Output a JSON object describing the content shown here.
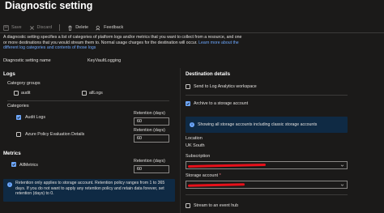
{
  "title": "Diagnostic setting",
  "toolbar": {
    "save": "Save",
    "discard": "Discard",
    "delete": "Delete",
    "feedback": "Feedback"
  },
  "description": {
    "text": "A diagnostic setting specifies a list of categories of platform logs and/or metrics that you want to collect from a resource, and one or more destinations that you would stream them to. Normal usage charges for the destination will occur.",
    "link1": "Learn",
    "link2": "more about the different log categories and contents of those logs"
  },
  "setting_name": {
    "label": "Diagnostic setting name",
    "value": "KeyVaultLogging"
  },
  "logs": {
    "heading": "Logs",
    "category_groups": {
      "label": "Category groups",
      "items": [
        {
          "label": "audit",
          "checked": false
        },
        {
          "label": "allLogs",
          "checked": false
        }
      ]
    },
    "categories": {
      "label": "Categories",
      "items": [
        {
          "label": "Audit Logs",
          "checked": true,
          "retention": "60"
        },
        {
          "label": "Azure Policy Evaluation Details",
          "checked": false,
          "retention": "60"
        }
      ],
      "retention_label": "Retention (days)"
    }
  },
  "metrics": {
    "heading": "Metrics",
    "items": [
      {
        "label": "AllMetrics",
        "checked": true,
        "retention": "60"
      }
    ],
    "retention_label": "Retention (days)",
    "info": "Retention only applies to storage account. Retention policy ranges from 1 to 365 days. If you do not want to apply any retention policy and retain data forever, set retention (days) to 0."
  },
  "destination": {
    "heading": "Destination details",
    "options": [
      {
        "label": "Send to Log Analytics workspace",
        "checked": false
      },
      {
        "label": "Archive to a storage account",
        "checked": true
      },
      {
        "label": "Stream to an event hub",
        "checked": false
      }
    ],
    "storage_info": "Showing all storage accounts including classic storage accounts",
    "location": {
      "label": "Location",
      "value": "UK South"
    },
    "subscription": {
      "label": "Subscription",
      "required_mark": ""
    },
    "storage_account": {
      "label": "Storage account",
      "required_mark": "*"
    }
  },
  "colors": {
    "background": "#1b1a19",
    "accent": "#6ea8fe",
    "info_bg": "#0f2a44",
    "redaction": "#e8101a"
  }
}
